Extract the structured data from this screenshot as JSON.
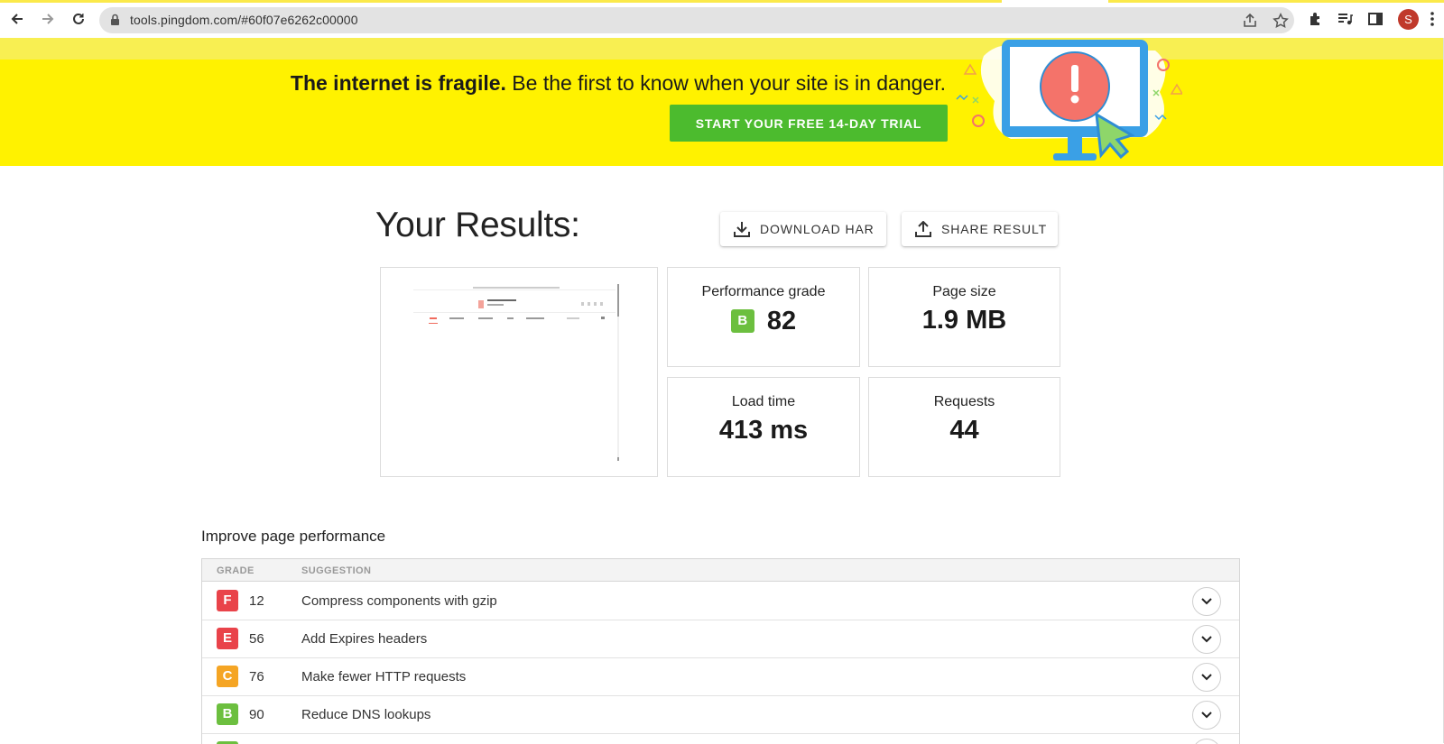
{
  "browser": {
    "url": "tools.pingdom.com/#60f07e6262c00000",
    "profile_initial": "S",
    "profile_color": "#c0392b"
  },
  "banner": {
    "headline_bold": "The internet is fragile.",
    "headline_rest": " Be the first to know when your site is in danger.",
    "cta_label": "START YOUR FREE 14-DAY TRIAL",
    "bg_color": "#fff200",
    "cta_color": "#4cbb2e"
  },
  "results": {
    "title": "Your Results:",
    "download_label": "DOWNLOAD HAR",
    "share_label": "SHARE RESULT",
    "metrics": {
      "performance_grade": {
        "label": "Performance grade",
        "grade": "B",
        "value": "82",
        "grade_color": "#6cbf3f"
      },
      "page_size": {
        "label": "Page size",
        "value": "1.9 MB"
      },
      "load_time": {
        "label": "Load time",
        "value": "413 ms"
      },
      "requests": {
        "label": "Requests",
        "value": "44"
      }
    }
  },
  "improve": {
    "title": "Improve page performance",
    "columns": [
      "GRADE",
      "SUGGESTION"
    ],
    "rows": [
      {
        "grade": "F",
        "score": "12",
        "suggestion": "Compress components with gzip",
        "color": "#e9434a"
      },
      {
        "grade": "E",
        "score": "56",
        "suggestion": "Add Expires headers",
        "color": "#e9434a"
      },
      {
        "grade": "C",
        "score": "76",
        "suggestion": "Make fewer HTTP requests",
        "color": "#f5a524"
      },
      {
        "grade": "B",
        "score": "90",
        "suggestion": "Reduce DNS lookups",
        "color": "#6cbf3f"
      },
      {
        "grade": "",
        "score": "",
        "suggestion": "",
        "color": "#6cbf3f"
      }
    ]
  }
}
